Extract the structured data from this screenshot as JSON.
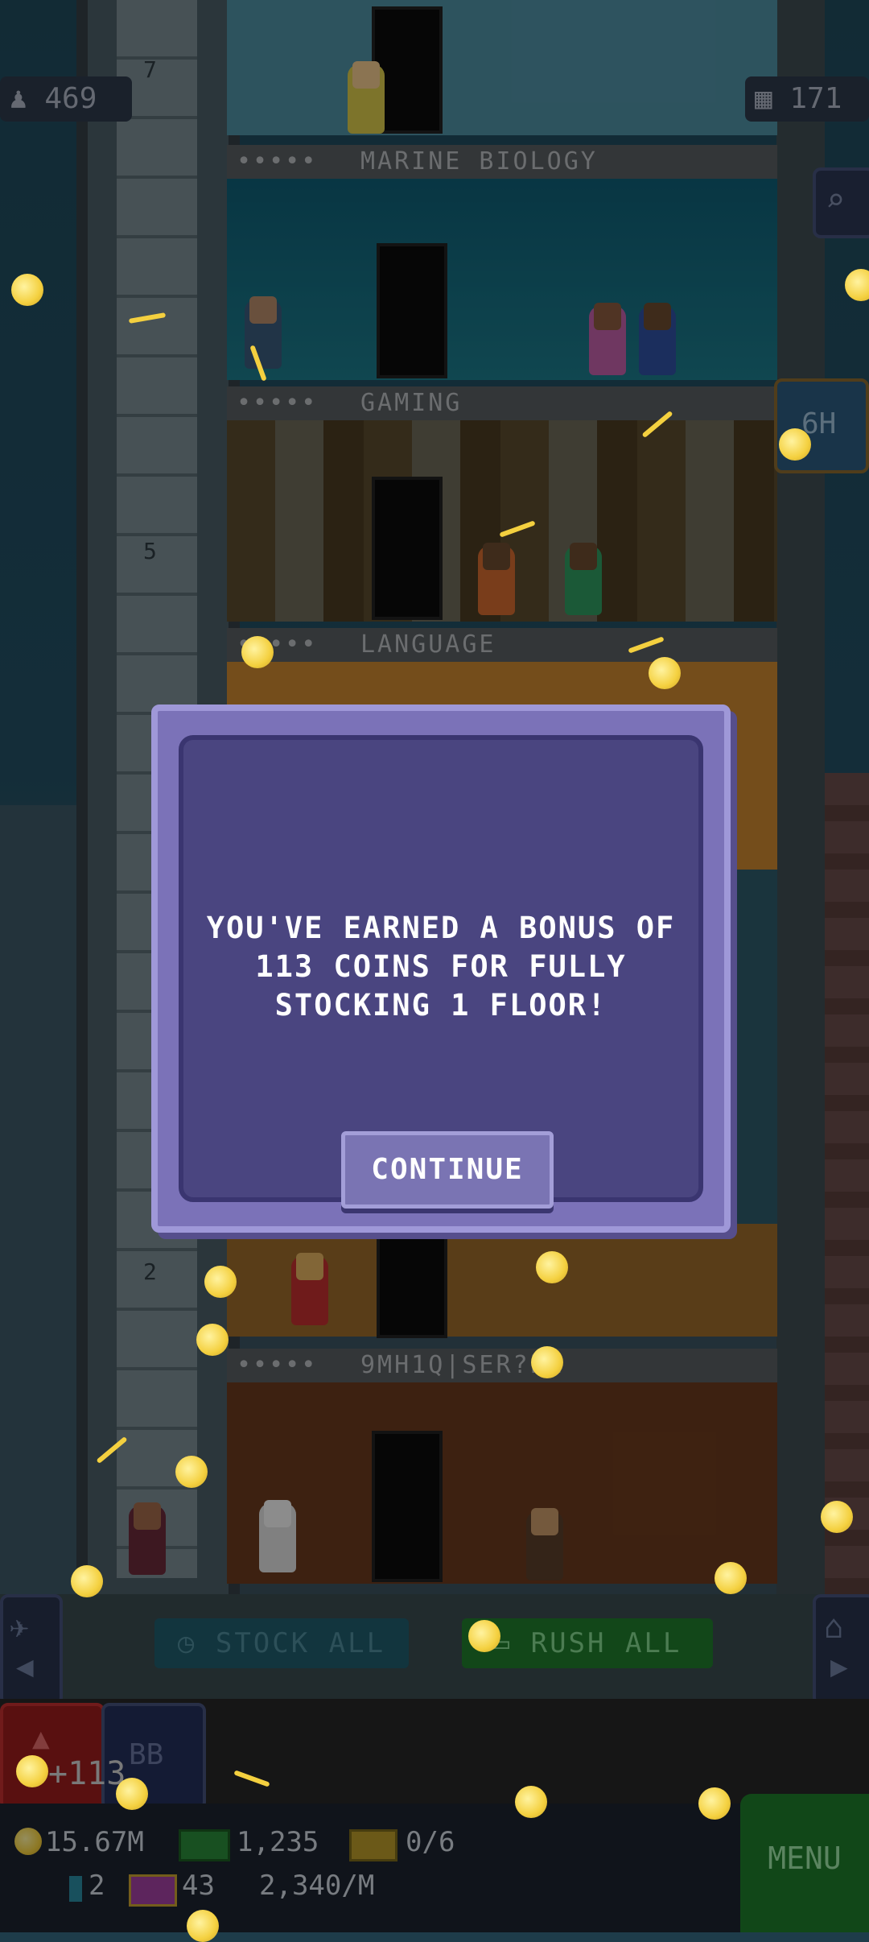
{
  "hud": {
    "population": "469",
    "floors": "171",
    "search_label": "search"
  },
  "floors": [
    {
      "name": "MARINE BIOLOGY",
      "people": "•••••",
      "number": ""
    },
    {
      "name": "GAMING",
      "people": "•••••",
      "number": "5"
    },
    {
      "name": "LANGUAGE",
      "people": "•••••",
      "number": ""
    },
    {
      "name": "9MH1Q|SER?PM",
      "people": "•••••",
      "number": ""
    }
  ],
  "elevator_numbers": [
    "7",
    "5",
    "2"
  ],
  "side_badge": "6H",
  "actions": {
    "stock_all": "STOCK ALL",
    "rush_all": "RUSH ALL"
  },
  "bottom": {
    "bb_label": "BB",
    "coin_gain": "+113",
    "coins": "15.67M",
    "bux": "1,235",
    "progress": "0/6",
    "gems": "2",
    "tickets": "43",
    "rate": "2,340/M",
    "menu": "MENU"
  },
  "dialog": {
    "message": "YOU'VE EARNED A BONUS OF 113 COINS FOR FULLY STOCKING 1 FLOOR!",
    "continue_label": "CONTINUE"
  },
  "colors": {
    "dialog_bg": "#4a4580",
    "dialog_frame": "#7b72b8",
    "coin": "#f4d03f",
    "rush_green": "#1e7a2a"
  }
}
